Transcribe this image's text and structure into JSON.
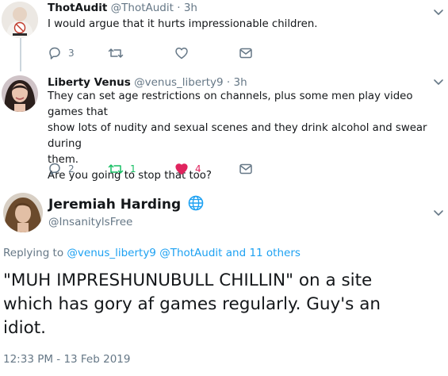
{
  "tweets": [
    {
      "name": "ThotAudit",
      "handle": "@ThotAudit",
      "separator": "·",
      "time": "3h",
      "text": "I would argue that it hurts impressionable children.",
      "replies": "3",
      "retweets": "",
      "likes": "",
      "liked": false,
      "retweeted": false
    },
    {
      "name": "Liberty Venus",
      "handle": "@venus_liberty9",
      "separator": "·",
      "time": "3h",
      "text_lines": [
        "They can set age restrictions on channels, plus some men play video games that",
        "show lots of nudity and sexual scenes and they drink alcohol and swear during",
        "them.",
        "Are you going to stop that too?"
      ],
      "replies": "2",
      "retweets": "1",
      "likes": "4",
      "liked": true,
      "retweeted": true
    }
  ],
  "main_tweet": {
    "name": "Jeremiah Harding",
    "handle": "@InsanitylsFree",
    "replying_prefix": "Replying to",
    "replying_users": [
      "@venus_liberty9",
      "@ThotAudit"
    ],
    "replying_suffix": "and 11 others",
    "text_lines": [
      "\"MUH IMPRESHUNUBULL CHILLIN\" on a site",
      "which has gory af games regularly. Guy's an",
      "idiot."
    ],
    "timestamp": "12:33 PM - 13 Feb 2019"
  },
  "colors": {
    "accent": "#1da1f2",
    "retweet": "#17bf63",
    "like": "#e0245e",
    "muted": "#657786",
    "text": "#14171a"
  },
  "icons": [
    "reply-icon",
    "retweet-icon",
    "like-icon",
    "dm-icon",
    "chevron-down-icon",
    "globe-icon"
  ]
}
